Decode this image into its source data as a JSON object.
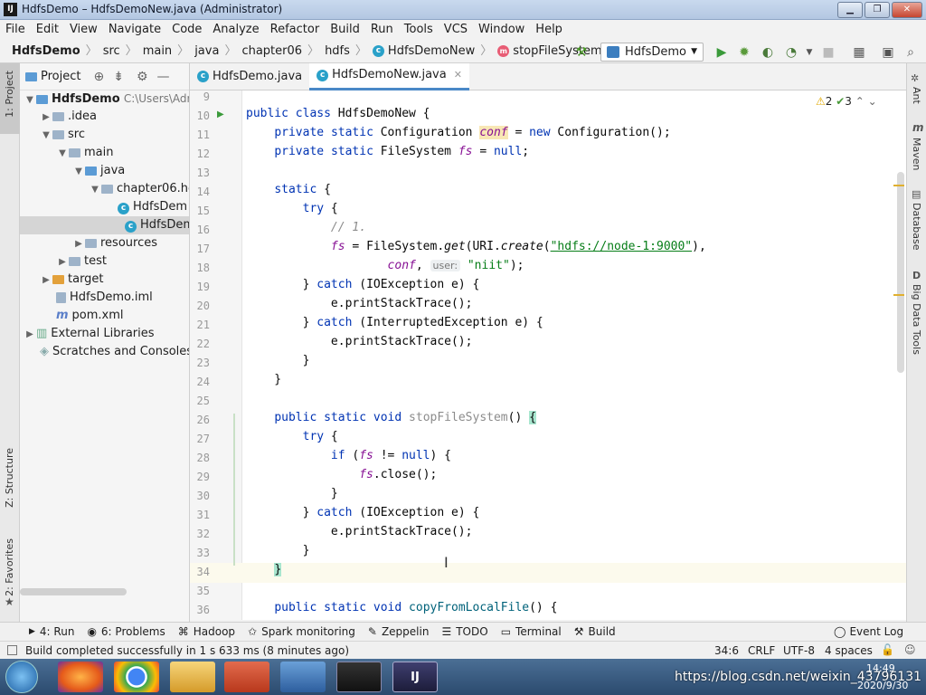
{
  "window": {
    "title": "HdfsDemo – HdfsDemoNew.java (Administrator)",
    "app_icon": "IJ"
  },
  "menu": [
    "File",
    "Edit",
    "View",
    "Navigate",
    "Code",
    "Analyze",
    "Refactor",
    "Build",
    "Run",
    "Tools",
    "VCS",
    "Window",
    "Help"
  ],
  "breadcrumb": [
    "HdfsDemo",
    "src",
    "main",
    "java",
    "chapter06",
    "hdfs",
    "HdfsDemoNew",
    "stopFileSystem"
  ],
  "run_config": "HdfsDemo",
  "project": {
    "header": "Project",
    "root_path": "C:\\Users\\Adr",
    "tree": [
      {
        "label": "HdfsDemo",
        "bold": true
      },
      {
        "label": ".idea"
      },
      {
        "label": "src"
      },
      {
        "label": "main"
      },
      {
        "label": "java"
      },
      {
        "label": "chapter06.hc"
      },
      {
        "label": "HdfsDem"
      },
      {
        "label": "HdfsDem"
      },
      {
        "label": "resources"
      },
      {
        "label": "test"
      },
      {
        "label": "target"
      },
      {
        "label": "HdfsDemo.iml"
      },
      {
        "label": "pom.xml"
      },
      {
        "label": "External Libraries"
      },
      {
        "label": "Scratches and Consoles"
      }
    ]
  },
  "left_stripe": {
    "project": "1: Project",
    "structure": "Z: Structure",
    "favorites": "2: Favorites"
  },
  "tabs": [
    {
      "label": "HdfsDemo.java"
    },
    {
      "label": "HdfsDemoNew.java"
    }
  ],
  "inspections": {
    "warnings": "2",
    "checks": "3"
  },
  "code": {
    "line_numbers": [
      "9",
      "10",
      "11",
      "12",
      "13",
      "14",
      "15",
      "16",
      "17",
      "18",
      "19",
      "20",
      "21",
      "22",
      "23",
      "24",
      "25",
      "26",
      "27",
      "28",
      "29",
      "30",
      "31",
      "32",
      "33",
      "34",
      "35",
      "36"
    ],
    "keywords": {
      "public": "public",
      "class": "class",
      "private": "private",
      "static": "static",
      "new": "new",
      "try": "try",
      "catch": "catch",
      "if": "if",
      "void": "void"
    },
    "class_name": "HdfsDemoNew",
    "types": {
      "configuration": "Configuration",
      "filesystem": "FileSystem",
      "ioexception": "IOException",
      "interrupted": "InterruptedException",
      "uri": "URI"
    },
    "fields": {
      "conf": "conf",
      "fs": "fs"
    },
    "null": "null",
    "comment": "// 1.",
    "methods": {
      "get": "get",
      "create": "create",
      "print": "printStackTrace",
      "close": "close",
      "stop": "stopFileSystem",
      "copy": "copyFromLocalFile"
    },
    "vars": {
      "e": "e"
    },
    "url_string": "\"hdfs://node-1:9000\"",
    "user_hint": "user:",
    "user_string": "\"niit\""
  },
  "right_stripe": {
    "ant": "Ant",
    "maven": "Maven",
    "database": "Database",
    "bigdata": "Big Data Tools"
  },
  "tool_windows": [
    {
      "label": "4: Run"
    },
    {
      "label": "6: Problems"
    },
    {
      "label": "Hadoop"
    },
    {
      "label": "Spark monitoring"
    },
    {
      "label": "Zeppelin"
    },
    {
      "label": "TODO"
    },
    {
      "label": "Terminal"
    },
    {
      "label": "Build"
    }
  ],
  "event_log": "Event Log",
  "status": {
    "message": "Build completed successfully in 1 s 633 ms (8 minutes ago)",
    "position": "34:6",
    "line_sep": "CRLF",
    "encoding": "UTF-8",
    "indent": "4 spaces"
  },
  "taskbar": {
    "time": "14:49",
    "date": "2020/9/30",
    "watermark": "https://blog.csdn.net/weixin_43796131"
  },
  "colors": {
    "keyword": "#0033b3",
    "field": "#871094",
    "string": "#067d17",
    "method": "#00627a",
    "comment": "#8c8c8c"
  }
}
